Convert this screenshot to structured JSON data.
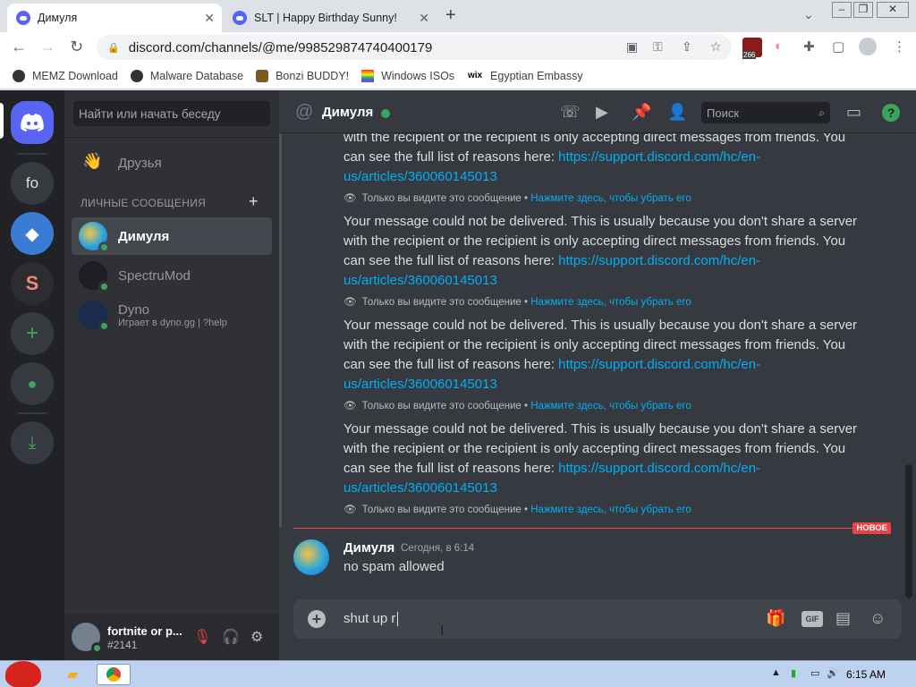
{
  "browser": {
    "tabs": [
      {
        "title": "Димуля",
        "active": true
      },
      {
        "title": "SLT | Happy Birthday Sunny!",
        "active": false
      }
    ],
    "url": "discord.com/channels/@me/998529874740400179",
    "bookmarks": [
      "MEMZ Download",
      "Malware Database",
      "Bonzi BUDDY!",
      "Windows ISOs",
      "Egyptian Embassy"
    ],
    "extension_badge": "266"
  },
  "discord": {
    "guilds": [
      {
        "name": "home-icon"
      },
      {
        "label": "fo"
      }
    ],
    "dm_search_placeholder": "Найти или начать беседу",
    "friends_label": "Друзья",
    "dm_header": "ЛИЧНЫЕ СООБЩЕНИЯ",
    "dms": [
      {
        "name": "Димуля",
        "sub": "",
        "selected": true
      },
      {
        "name": "SpectruMod",
        "sub": "",
        "selected": false
      },
      {
        "name": "Dyno",
        "sub": "Играет в dyno.gg | ?help",
        "selected": false
      }
    ],
    "user": {
      "name": "fortnite or p...",
      "tag": "#2141"
    },
    "chat": {
      "title": "Димуля",
      "search_placeholder": "Поиск",
      "partial_message_line1": "with the recipient or the recipient is only accepting direct messages from friends. You",
      "partial_message_line2": "can see the full list of reasons here: ",
      "message_text": "Your message could not be delivered. This is usually because you don't share a server with the recipient or the recipient is only accepting direct messages from friends. You can see the full list of reasons here: ",
      "message_link": "https://support.discord.com/hc/en-us/articles/360060145013",
      "ephemeral_note": "Только вы видите это сообщение •",
      "ephemeral_dismiss": "Нажмите здесь, чтобы убрать его",
      "new_label": "НОВОЕ",
      "last_message": {
        "author": "Димуля",
        "time": "Сегодня, в 6:14",
        "text": "no spam allowed"
      },
      "composer_value": "shut up r"
    }
  },
  "taskbar": {
    "clock": "6:15 AM"
  }
}
